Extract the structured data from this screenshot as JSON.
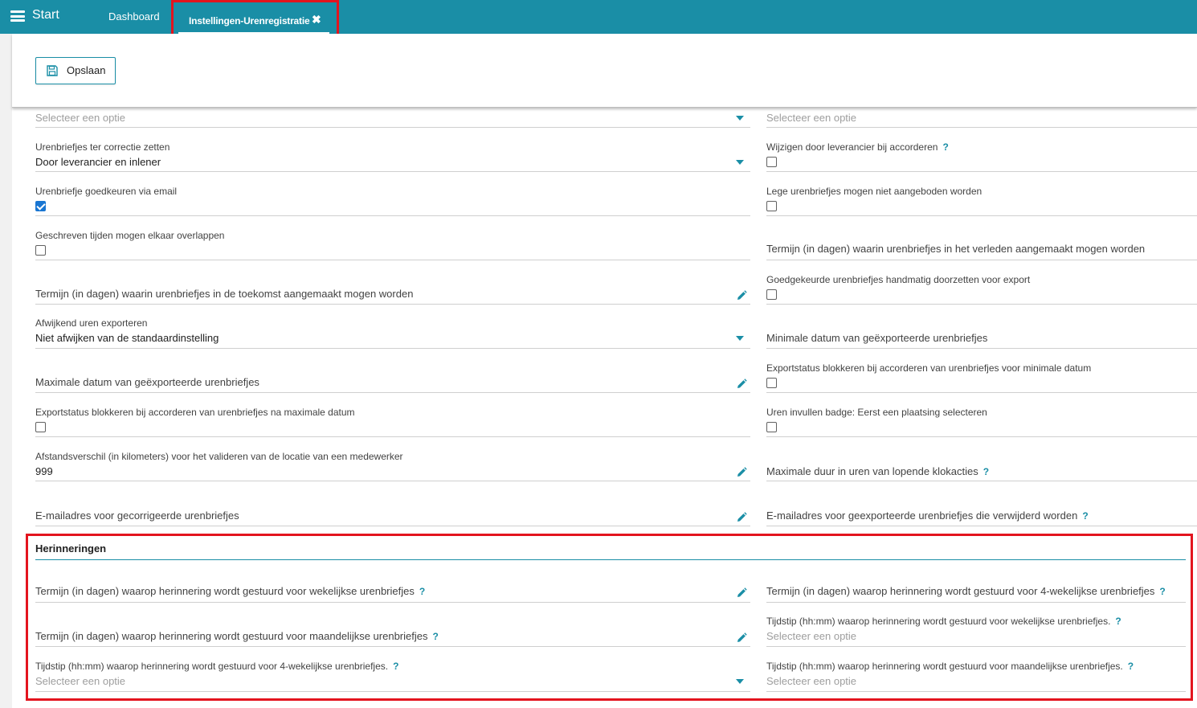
{
  "topbar": {
    "start_label": "Start",
    "tabs": [
      {
        "label": "Dashboard"
      },
      {
        "label": "Instellingen-Urenregistratie",
        "close": "✖"
      }
    ]
  },
  "toolbar": {
    "save_label": "Opslaan"
  },
  "fields": {
    "l0": {
      "placeholder": "Selecteer een optie"
    },
    "r0": {
      "placeholder": "Selecteer een optie"
    },
    "l1": {
      "label": "Urenbriefjes ter correctie zetten",
      "value": "Door leverancier en inlener"
    },
    "r1": {
      "label": "Wijzigen door leverancier bij accorderen",
      "help": "?",
      "checked": false
    },
    "l2": {
      "label": "Urenbriefje goedkeuren via email",
      "checked": true
    },
    "r2": {
      "label": "Lege urenbriefjes mogen niet aangeboden worden",
      "checked": false
    },
    "l3": {
      "label": "Geschreven tijden mogen elkaar overlappen",
      "checked": false
    },
    "r3": {
      "label": "Termijn (in dagen) waarin urenbriefjes in het verleden aangemaakt mogen worden"
    },
    "l4": {
      "label": "Termijn (in dagen) waarin urenbriefjes in de toekomst aangemaakt mogen worden"
    },
    "r4": {
      "label": "Goedgekeurde urenbriefjes handmatig doorzetten voor export",
      "checked": false
    },
    "l5": {
      "label": "Afwijkend uren exporteren",
      "value": "Niet afwijken van de standaardinstelling"
    },
    "r5": {
      "label": "Minimale datum van geëxporteerde urenbriefjes"
    },
    "l6": {
      "label": "Maximale datum van geëxporteerde urenbriefjes"
    },
    "r6": {
      "label": "Exportstatus blokkeren bij accorderen van urenbriefjes voor minimale datum",
      "checked": false
    },
    "l7": {
      "label": "Exportstatus blokkeren bij accorderen van urenbriefjes na maximale datum",
      "checked": false
    },
    "r7": {
      "label": "Uren invullen badge: Eerst een plaatsing selecteren",
      "checked": false
    },
    "l8": {
      "label": "Afstandsverschil (in kilometers) voor het valideren van de locatie van een medewerker",
      "value": "999"
    },
    "r8": {
      "label": "Maximale duur in uren van lopende klokacties",
      "help": "?"
    },
    "l9": {
      "label": "E-mailadres voor gecorrigeerde urenbriefjes"
    },
    "r9": {
      "label": "E-mailadres voor geexporteerde urenbriefjes die verwijderd worden",
      "help": "?"
    }
  },
  "reminders": {
    "title": "Herinneringen",
    "l1": {
      "label": "Termijn (in dagen) waarop herinnering wordt gestuurd voor wekelijkse urenbriefjes",
      "help": "?"
    },
    "r1": {
      "label": "Termijn (in dagen) waarop herinnering wordt gestuurd voor 4-wekelijkse urenbriefjes",
      "help": "?"
    },
    "l2": {
      "label": "Termijn (in dagen) waarop herinnering wordt gestuurd voor maandelijkse urenbriefjes",
      "help": "?"
    },
    "r2": {
      "label": "Tijdstip (hh:mm) waarop herinnering wordt gestuurd voor wekelijkse urenbriefjes.",
      "help": "?",
      "placeholder": "Selecteer een optie"
    },
    "l3": {
      "label": "Tijdstip (hh:mm) waarop herinnering wordt gestuurd voor 4-wekelijkse urenbriefjes.",
      "help": "?",
      "placeholder": "Selecteer een optie"
    },
    "r3": {
      "label": "Tijdstip (hh:mm) waarop herinnering wordt gestuurd voor maandelijkse urenbriefjes.",
      "help": "?",
      "placeholder": "Selecteer een optie"
    }
  },
  "colors": {
    "accent": "#1a8ea6",
    "highlight": "#e3141e",
    "checkbox": "#1976d2"
  },
  "icons": [
    "menu-icon",
    "close-icon",
    "save-icon",
    "chevron-down-icon",
    "pencil-icon",
    "help-icon"
  ]
}
